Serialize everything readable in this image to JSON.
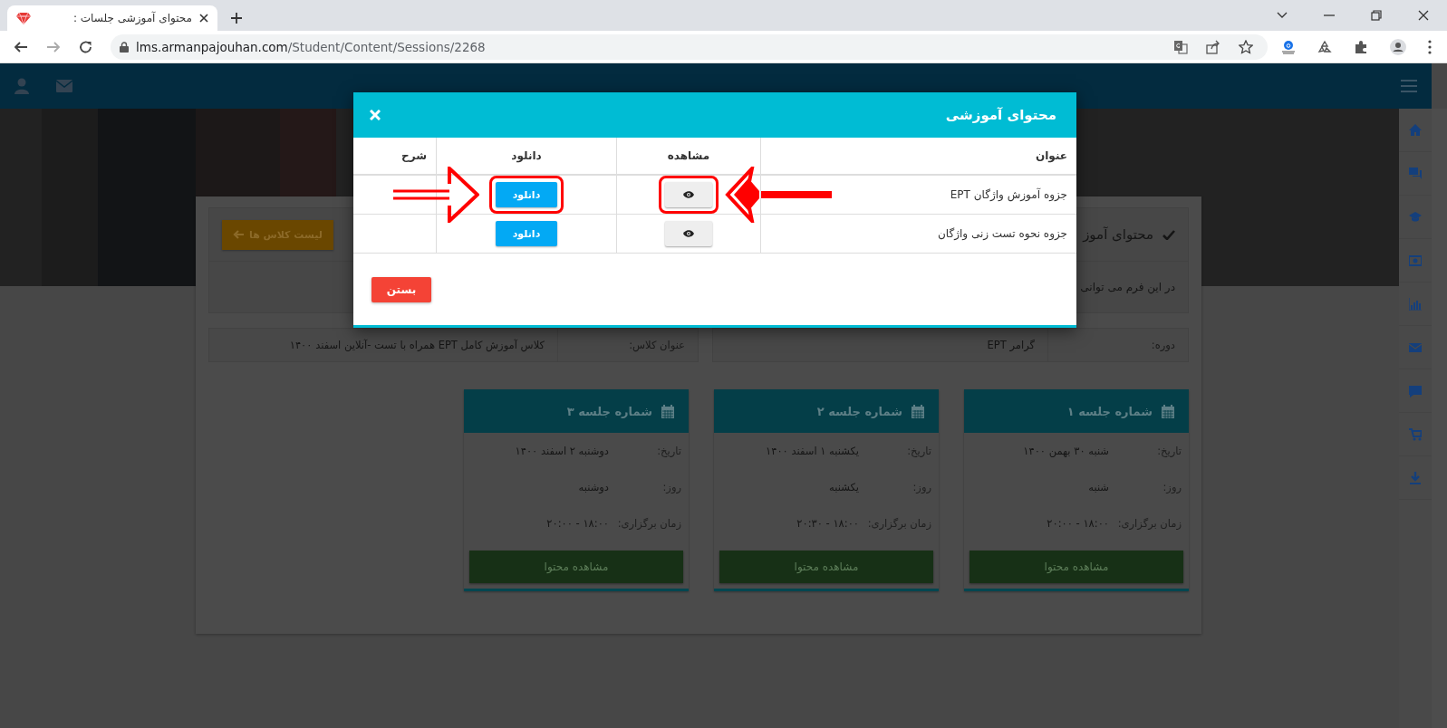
{
  "browser": {
    "tab_title": "محتوای آموزشی جلسات :",
    "url_host": "lms.armanpajouhan.com",
    "url_path": "/Student/Content/Sessions/2268"
  },
  "panel": {
    "title": "محتوای آموز",
    "back_button": "لیست کلاس ها",
    "description": "در این فرم می توانی"
  },
  "info": [
    {
      "label": "دوره:",
      "value": "گرامر EPT"
    },
    {
      "label": "عنوان کلاس:",
      "value": "کلاس آموزش کامل EPT همراه با تست -آنلاین اسفند ۱۴۰۰"
    }
  ],
  "sessions": [
    {
      "title": "شماره جلسه ۱",
      "fields": [
        {
          "label": "تاریخ:",
          "value": "شنبه ۳۰ بهمن ۱۴۰۰"
        },
        {
          "label": "روز:",
          "value": "شنبه"
        },
        {
          "label": "زمان برگزاری:",
          "value": "۱۸:۰۰ - ۲۰:۰۰"
        }
      ],
      "button": "مشاهده محتوا"
    },
    {
      "title": "شماره جلسه ۲",
      "fields": [
        {
          "label": "تاریخ:",
          "value": "یکشنبه ۱ اسفند ۱۴۰۰"
        },
        {
          "label": "روز:",
          "value": "یکشنبه"
        },
        {
          "label": "زمان برگزاری:",
          "value": "۱۸:۰۰ - ۲۰:۳۰"
        }
      ],
      "button": "مشاهده محتوا"
    },
    {
      "title": "شماره جلسه ۳",
      "fields": [
        {
          "label": "تاریخ:",
          "value": "دوشنبه ۲ اسفند ۱۴۰۰"
        },
        {
          "label": "روز:",
          "value": "دوشنبه"
        },
        {
          "label": "زمان برگزاری:",
          "value": "۱۸:۰۰ - ۲۰:۰۰"
        }
      ],
      "button": "مشاهده محتوا"
    }
  ],
  "modal": {
    "title": "محتوای آموزشی",
    "columns": [
      "عنوان",
      "مشاهده",
      "دانلود",
      "شرح"
    ],
    "rows": [
      {
        "title": "جزوه آموزش واژگان EPT",
        "download": "دانلود",
        "highlighted": true
      },
      {
        "title": "جزوه نحوه تست زنی واژگان",
        "download": "دانلود",
        "highlighted": false
      }
    ],
    "close_button": "بستن"
  }
}
